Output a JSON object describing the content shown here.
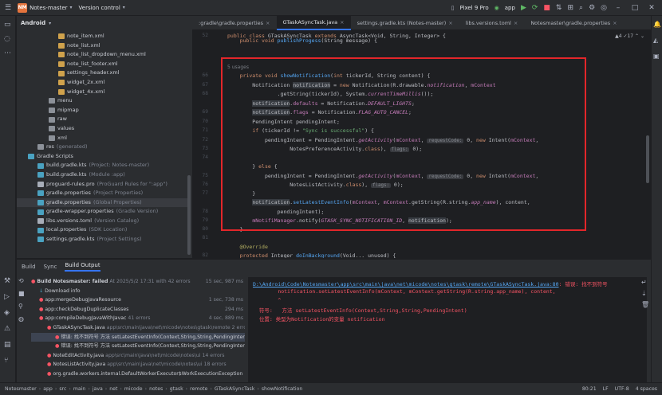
{
  "topbar": {
    "project_badge": "NM",
    "project_name": "Notes-master",
    "vcs": "Version control",
    "device": "Pixel 9 Pro",
    "run_config": "app"
  },
  "project_panel": {
    "title": "Android",
    "rows": [
      {
        "label": "note_item.xml",
        "extra": "",
        "icon": "xml"
      },
      {
        "label": "note_list.xml",
        "extra": "",
        "icon": "xml"
      },
      {
        "label": "note_list_dropdown_menu.xml",
        "extra": "",
        "icon": "xml"
      },
      {
        "label": "note_list_footer.xml",
        "extra": "",
        "icon": "xml"
      },
      {
        "label": "settings_header.xml",
        "extra": "",
        "icon": "xml"
      },
      {
        "label": "widget_2x.xml",
        "extra": "",
        "icon": "xml"
      },
      {
        "label": "widget_4x.xml",
        "extra": "",
        "icon": "xml"
      },
      {
        "label": "menu",
        "extra": "",
        "icon": "folder"
      },
      {
        "label": "mipmap",
        "extra": "",
        "icon": "folder"
      },
      {
        "label": "raw",
        "extra": "",
        "icon": "folder"
      },
      {
        "label": "values",
        "extra": "",
        "icon": "folder"
      },
      {
        "label": "xml",
        "extra": "",
        "icon": "folder"
      },
      {
        "label": "res",
        "extra": "(generated)",
        "icon": "folder"
      },
      {
        "label": "Gradle Scripts",
        "extra": "",
        "icon": "gradle"
      },
      {
        "label": "build.gradle.kts",
        "extra": "(Project: Notes-master)",
        "icon": "gradle"
      },
      {
        "label": "build.gradle.kts",
        "extra": "(Module :app)",
        "icon": "gradle"
      },
      {
        "label": "proguard-rules.pro",
        "extra": "(ProGuard Rules for \":app\")",
        "icon": "file"
      },
      {
        "label": "gradle.properties",
        "extra": "(Project Properties)",
        "icon": "gradle"
      },
      {
        "label": "gradle.properties",
        "extra": "(Global Properties)",
        "icon": "gradle"
      },
      {
        "label": "gradle-wrapper.properties",
        "extra": "(Gradle Version)",
        "icon": "gradle"
      },
      {
        "label": "libs.versions.toml",
        "extra": "(Version Catalog)",
        "icon": "file"
      },
      {
        "label": "local.properties",
        "extra": "(SDK Location)",
        "icon": "gradle"
      },
      {
        "label": "settings.gradle.kts",
        "extra": "(Project Settings)",
        "icon": "gradle"
      }
    ]
  },
  "editor": {
    "tabs": [
      {
        "label": ":gradle\\gradle.properties",
        "active": false
      },
      {
        "label": "GTaskASyncTask.java",
        "active": true
      },
      {
        "label": "settings.gradle.kts (Notes-master)",
        "active": false
      },
      {
        "label": "libs.versions.toml",
        "active": false
      },
      {
        "label": "Notesmaster\\gradle.properties",
        "active": false
      }
    ],
    "line_numbers": [
      "52",
      "",
      "",
      "",
      "66",
      "67",
      "68",
      "",
      "69",
      "70",
      "71",
      "72",
      "73",
      "74",
      "",
      "75",
      "76",
      "77",
      "",
      "78",
      "79",
      "80",
      "81",
      "",
      "82",
      "",
      "",
      "83",
      "84",
      "85"
    ],
    "usages": "5 usages",
    "inspection": "▲4  ✓17  ⌃  ⌄"
  },
  "bottom": {
    "tabs": [
      "Build",
      "Sync",
      "Build Output"
    ],
    "tree": [
      {
        "text": "Build Notesmaster: failed",
        "extra": "At 2025/5/2 17:31 with 42 errors",
        "time": "15 sec, 987 ms",
        "kind": "err"
      },
      {
        "text": "Download info",
        "extra": "",
        "time": "",
        "kind": "info"
      },
      {
        "text": "app:mergeDebugJavaResource",
        "extra": "",
        "time": "1 sec, 738 ms",
        "kind": "err"
      },
      {
        "text": "app:checkDebugDuplicateClasses",
        "extra": "",
        "time": "294 ms",
        "kind": "err"
      },
      {
        "text": "app:compileDebugJavaWithJavac",
        "extra": "41 errors",
        "time": "4 sec, 889 ms",
        "kind": "err"
      },
      {
        "text": "GTaskASyncTask.java",
        "extra": "app\\src\\main\\java\\net\\micode\\notes\\gtask\\remote 2 errors",
        "time": "",
        "kind": "err"
      },
      {
        "text": "错误: 找不到符号 方法 setLatestEventInfo(Context,String,String,PendingIntent)",
        "extra": "",
        "time": "",
        "kind": "err"
      },
      {
        "text": "错误: 找不到符号 方法 setLatestEventInfo(Context,String,String,PendingIntent)",
        "extra": "",
        "time": "",
        "kind": "err"
      },
      {
        "text": "NoteEditActivity.java",
        "extra": "app\\src\\main\\java\\net\\micode\\notes\\ui 14 errors",
        "time": "",
        "kind": "err"
      },
      {
        "text": "NotesListActivity.java",
        "extra": "app\\src\\main\\java\\net\\micode\\notes\\ui 18 errors",
        "time": "",
        "kind": "err"
      },
      {
        "text": "org.gradle.workers.internal.DefaultWorkerExecutor$WorkExecutionException",
        "extra": "",
        "time": "",
        "kind": "err"
      }
    ],
    "output": {
      "path": "D:\\Android\\Code\\Notesmaster\\app\\src\\main\\java\\net\\micode\\notes\\gtask\\remote\\GTaskASyncTask.java:80",
      "error": ": 错误: 找不到符号",
      "code": "notification.setLatestEventInfo(mContext, mContext.getString(R.string.app_name), content,",
      "caret": "^",
      "symbol": "符号:   方法 setLatestEventInfo(Context,String,String,PendingIntent)",
      "location": "位置: 类型为Notification的变量 notification"
    }
  },
  "status": {
    "breadcrumb": [
      "Notesmaster",
      "app",
      "src",
      "main",
      "java",
      "net",
      "micode",
      "notes",
      "gtask",
      "remote",
      "GTaskASyncTask",
      "showNotification"
    ],
    "position": "80:21",
    "line_sep": "LF",
    "encoding": "UTF-8",
    "indent": "4 spaces"
  }
}
